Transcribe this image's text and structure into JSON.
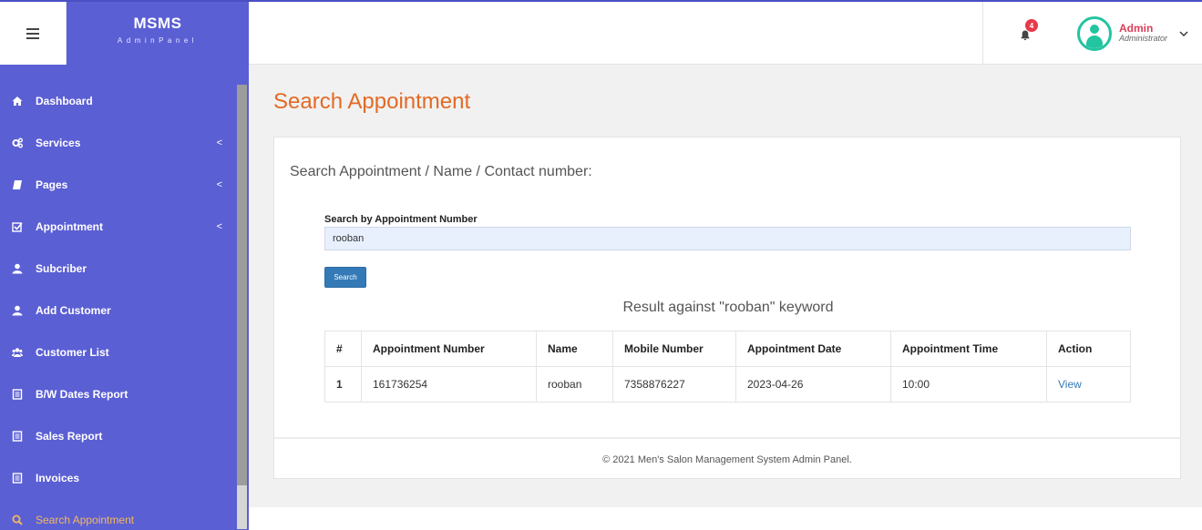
{
  "brand": {
    "title": "MSMS",
    "subtitle": "AdminPanel"
  },
  "notifications": {
    "count": "4"
  },
  "user": {
    "name": "Admin",
    "role": "Administrator"
  },
  "sidebar": {
    "items": [
      {
        "label": "Dashboard",
        "icon": "home-icon"
      },
      {
        "label": "Services",
        "icon": "cogs-icon",
        "arrow": "<"
      },
      {
        "label": "Pages",
        "icon": "book-icon",
        "arrow": "<"
      },
      {
        "label": "Appointment",
        "icon": "checkbox-icon",
        "arrow": "<"
      },
      {
        "label": "Subcriber",
        "icon": "user-icon"
      },
      {
        "label": "Add Customer",
        "icon": "user-icon"
      },
      {
        "label": "Customer List",
        "icon": "users-icon"
      },
      {
        "label": "B/W Dates Report",
        "icon": "file-icon"
      },
      {
        "label": "Sales Report",
        "icon": "file-icon"
      },
      {
        "label": "Invoices",
        "icon": "file-icon"
      },
      {
        "label": "Search Appointment",
        "icon": "search-icon"
      }
    ]
  },
  "main": {
    "title": "Search Appointment",
    "card_heading": "Search Appointment / Name / Contact number:",
    "search_label": "Search by Appointment Number",
    "search_value": "rooban",
    "search_button": "Search",
    "result_text": "Result against \"rooban\" keyword",
    "table": {
      "headers": [
        "#",
        "Appointment Number",
        "Name",
        "Mobile Number",
        "Appointment Date",
        "Appointment Time",
        "Action"
      ],
      "rows": [
        [
          "1",
          "161736254",
          "rooban",
          "7358876227",
          "2023-04-26",
          "10:00",
          "View"
        ]
      ]
    },
    "footer": "© 2021 Men's Salon Management System Admin Panel."
  },
  "colors": {
    "sidebar": "#5b5fd4",
    "title": "#e36a24",
    "active_nav": "#f4b85a",
    "button": "#337ab7"
  }
}
